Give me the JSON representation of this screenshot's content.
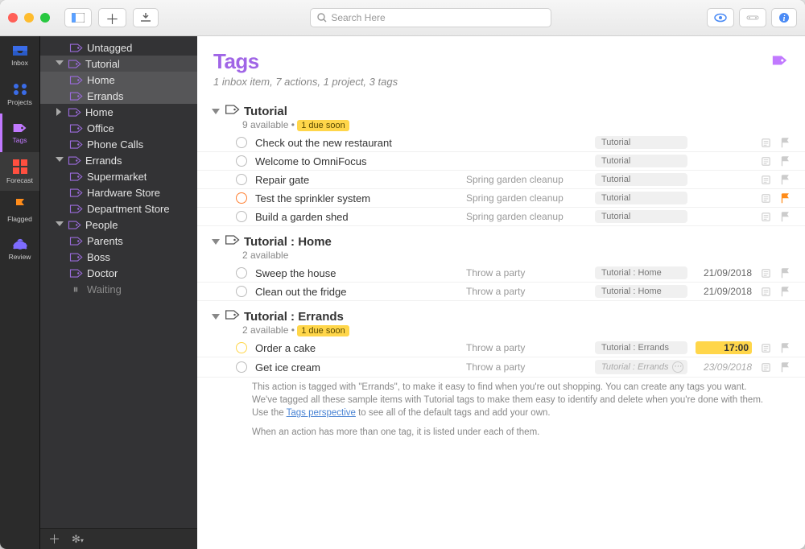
{
  "toolbar": {
    "search_placeholder": "Search Here"
  },
  "rail": {
    "inbox": "Inbox",
    "projects": "Projects",
    "tags": "Tags",
    "forecast": "Forecast",
    "flagged": "Flagged",
    "review": "Review"
  },
  "sidebar": {
    "items": [
      {
        "label": "Untagged"
      },
      {
        "label": "Tutorial"
      },
      {
        "label": "Home"
      },
      {
        "label": "Errands"
      },
      {
        "label": "Home"
      },
      {
        "label": "Office"
      },
      {
        "label": "Phone Calls"
      },
      {
        "label": "Errands"
      },
      {
        "label": "Supermarket"
      },
      {
        "label": "Hardware Store"
      },
      {
        "label": "Department Store"
      },
      {
        "label": "People"
      },
      {
        "label": "Parents"
      },
      {
        "label": "Boss"
      },
      {
        "label": "Doctor"
      },
      {
        "label": "Waiting"
      }
    ]
  },
  "main": {
    "title": "Tags",
    "subtitle": "1 inbox item, 7 actions, 1 project, 3 tags",
    "groups": [
      {
        "title": "Tutorial",
        "available": "9 available",
        "due_badge": "1 due soon",
        "rows": [
          {
            "title": "Check out the new restaurant",
            "project": "",
            "tag": "Tutorial",
            "date": "",
            "circle": "",
            "flag": false
          },
          {
            "title": "Welcome to OmniFocus",
            "project": "",
            "tag": "Tutorial",
            "date": "",
            "circle": "",
            "flag": false
          },
          {
            "title": "Repair gate",
            "project": "Spring garden cleanup",
            "tag": "Tutorial",
            "date": "",
            "circle": "",
            "flag": false
          },
          {
            "title": "Test the sprinkler system",
            "project": "Spring garden cleanup",
            "tag": "Tutorial",
            "date": "",
            "circle": "orange",
            "flag": true
          },
          {
            "title": "Build a garden shed",
            "project": "Spring garden cleanup",
            "tag": "Tutorial",
            "date": "",
            "circle": "",
            "flag": false
          }
        ]
      },
      {
        "title": "Tutorial : Home",
        "available": "2 available",
        "due_badge": "",
        "rows": [
          {
            "title": "Sweep the house",
            "project": "Throw a party",
            "tag": "Tutorial : Home",
            "date": "21/09/2018",
            "circle": "",
            "flag": false
          },
          {
            "title": "Clean out the fridge",
            "project": "Throw a party",
            "tag": "Tutorial : Home",
            "date": "21/09/2018",
            "circle": "",
            "flag": false
          }
        ]
      },
      {
        "title": "Tutorial : Errands",
        "available": "2 available",
        "due_badge": "1 due soon",
        "rows": [
          {
            "title": "Order a cake",
            "project": "Throw a party",
            "tag": "Tutorial : Errands",
            "date": "17:00",
            "circle": "yellow",
            "flag": false,
            "due": true
          },
          {
            "title": "Get ice cream",
            "project": "Throw a party",
            "tag": "Tutorial : Errands",
            "date": "23/09/2018",
            "circle": "",
            "flag": false,
            "italic": true,
            "extra_tag": true
          }
        ]
      }
    ],
    "note": {
      "p1": "This action is tagged with \"Errands\", to make it easy to find when you're out shopping. You can create any tags you want. We've tagged all these sample items with Tutorial tags to make them easy to identify and delete when you're done with them. Use the ",
      "link": "Tags perspective",
      "p1b": " to see all of the default tags and add your own.",
      "p2": "When an action has more than one tag, it is listed under each of them."
    }
  }
}
